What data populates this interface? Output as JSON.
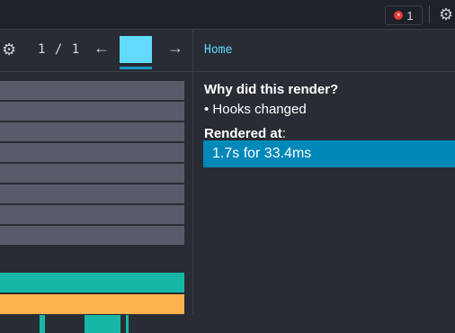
{
  "topbar": {
    "error_count": "1",
    "error_icon": "×",
    "settings_icon": "gear-icon"
  },
  "commits": {
    "counter": "1 / 1",
    "prev_icon": "←",
    "next_icon": "→",
    "bar_color": "#61dafb"
  },
  "flamegraph": {
    "bar_colors": {
      "unchanged": "#585c68",
      "teal": "#16b8a5",
      "gold": "#fcb24f"
    }
  },
  "details": {
    "breadcrumb": "Home",
    "why_title": "Why did this render?",
    "reason": "• Hooks changed",
    "rendered_label": "Rendered at",
    "rendered_colon": ":",
    "render_entry": "1.7s for 33.4ms",
    "accent": "#0088b8"
  }
}
